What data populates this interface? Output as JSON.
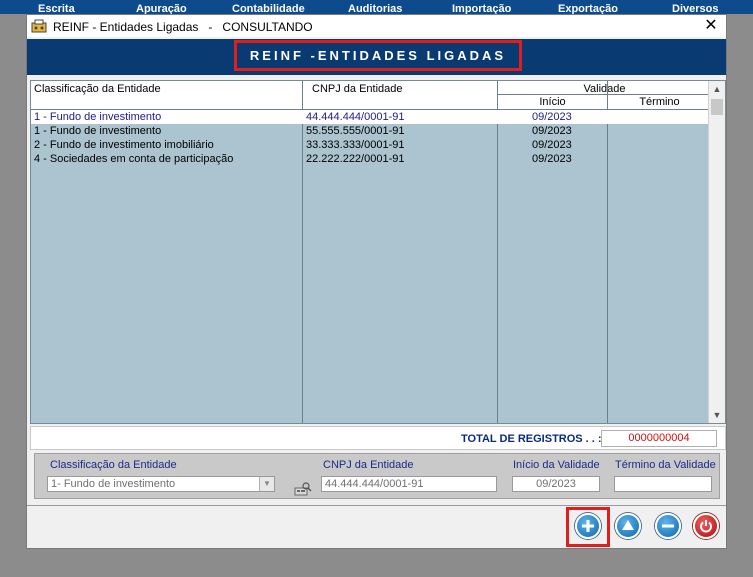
{
  "menu": [
    "Escrita",
    "Apuração",
    "Contabilidade",
    "Auditorias",
    "Importação",
    "Exportação",
    "Diversos"
  ],
  "window": {
    "title": "REINF - Entidades Ligadas   -   CONSULTANDO",
    "banner": "REINF -ENTIDADES LIGADAS"
  },
  "grid": {
    "headers": {
      "classificacao": "Classificação da Entidade",
      "cnpj": "CNPJ da Entidade",
      "validade": "Validade",
      "inicio": "Início",
      "termino": "Término"
    },
    "rows": [
      {
        "classificacao": "1 - Fundo de investimento",
        "cnpj": "44.444.444/0001-91",
        "inicio": "09/2023",
        "termino": ""
      },
      {
        "classificacao": "1 - Fundo de investimento",
        "cnpj": "55.555.555/0001-91",
        "inicio": "09/2023",
        "termino": ""
      },
      {
        "classificacao": "2 - Fundo de investimento imobiliário",
        "cnpj": "33.333.333/0001-91",
        "inicio": "09/2023",
        "termino": ""
      },
      {
        "classificacao": "4 - Sociedades em conta de participação",
        "cnpj": "22.222.222/0001-91",
        "inicio": "09/2023",
        "termino": ""
      }
    ]
  },
  "total": {
    "label": "TOTAL DE REGISTROS . . :",
    "value": "0000000004"
  },
  "form": {
    "classificacao_label": "Classificação da Entidade",
    "classificacao_value": "1- Fundo de investimento",
    "cnpj_label": "CNPJ da Entidade",
    "cnpj_value": "44.444.444/0001-91",
    "inicio_label": "Início da Validade",
    "inicio_value": "09/2023",
    "termino_label": "Término da Validade",
    "termino_value": ""
  },
  "icons": {
    "add": "plus-circle-icon",
    "up": "arrow-up-circle-icon",
    "remove": "minus-circle-icon",
    "exit": "power-icon"
  },
  "colors": {
    "banner": "#0a3a72",
    "grid": "#abc4cf",
    "highlight": "#e01e1e",
    "total_value": "#d01010"
  }
}
